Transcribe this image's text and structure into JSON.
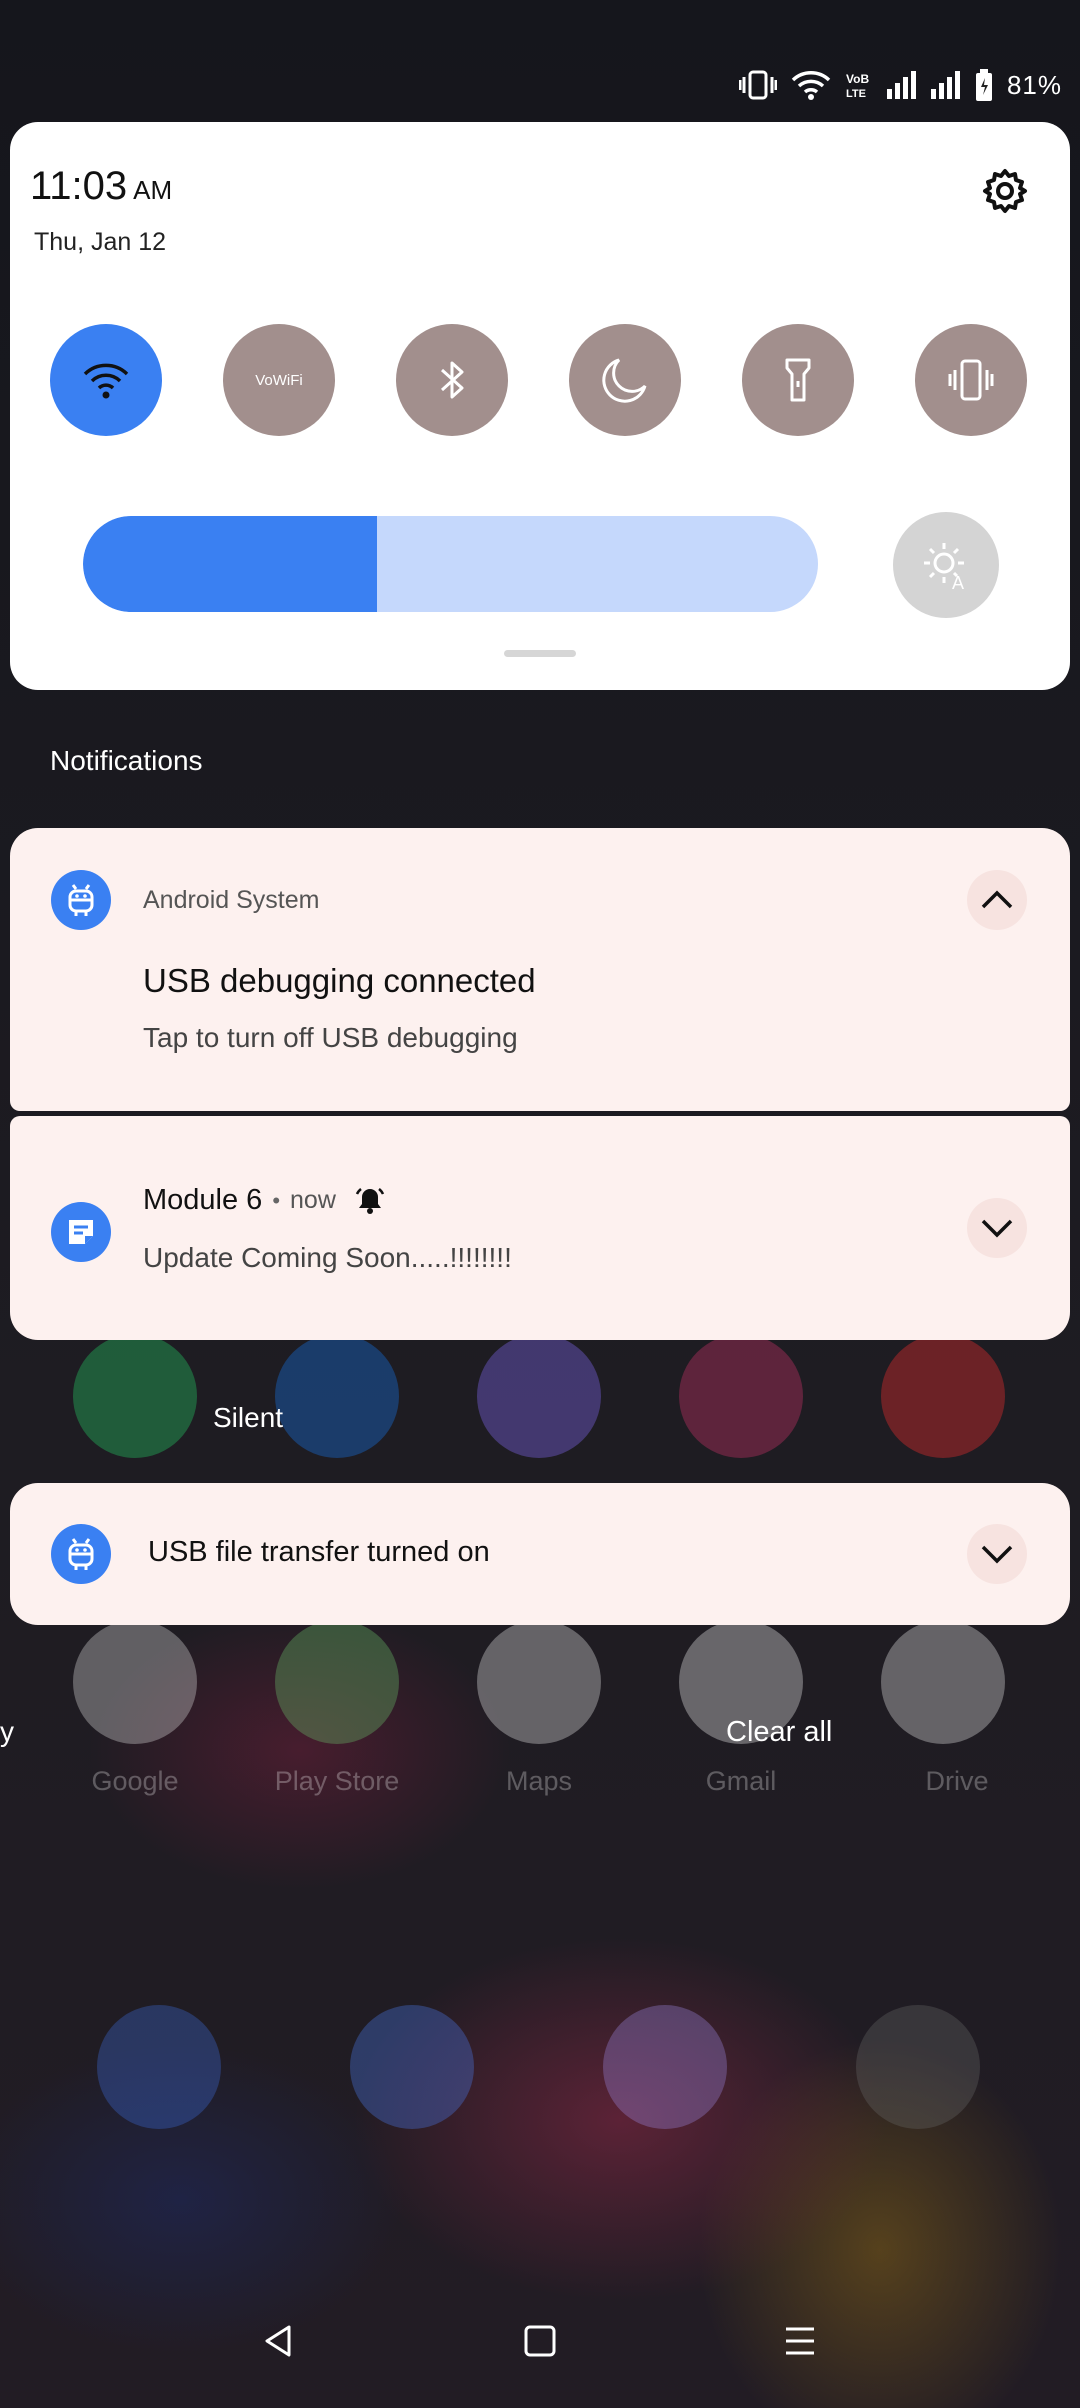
{
  "status_bar": {
    "battery": "81%",
    "icons": [
      "vibrate-icon",
      "wifi-icon",
      "volte-icon",
      "signal-icon",
      "signal-icon",
      "battery-icon"
    ]
  },
  "quick_settings": {
    "time": "11:03",
    "ampm": "AM",
    "date": "Thu, Jan 12",
    "tiles": [
      {
        "name": "wifi",
        "icon": "wifi-icon",
        "active": true
      },
      {
        "name": "vowifi",
        "label": "VoWiFi",
        "active": false
      },
      {
        "name": "bluetooth",
        "icon": "bluetooth-icon",
        "active": false
      },
      {
        "name": "do-not-disturb",
        "icon": "moon-icon",
        "active": false
      },
      {
        "name": "flashlight",
        "icon": "flashlight-icon",
        "active": false
      },
      {
        "name": "vibrate",
        "icon": "vibrate-icon",
        "active": false
      }
    ],
    "brightness_level": 0.4,
    "colors": {
      "accent": "#3a80f2",
      "tile_off": "#a28f8d",
      "card_bg": "#fdf1ef"
    }
  },
  "notifications": {
    "section_title": "Notifications",
    "items": [
      {
        "app": "Android System",
        "title": "USB debugging connected",
        "text": "Tap to turn off USB debugging",
        "expanded": true
      },
      {
        "app": "Module 6",
        "time": "now",
        "text": "Update Coming Soon.....!!!!!!!!",
        "expanded": false
      }
    ]
  },
  "silent": {
    "section_title": "Silent",
    "items": [
      {
        "title": "USB file transfer turned on"
      }
    ]
  },
  "clear_all": "Clear all",
  "home": {
    "labels": [
      "Google",
      "Play Store",
      "Maps",
      "Gmail",
      "Drive"
    ],
    "edge_text": "y"
  }
}
